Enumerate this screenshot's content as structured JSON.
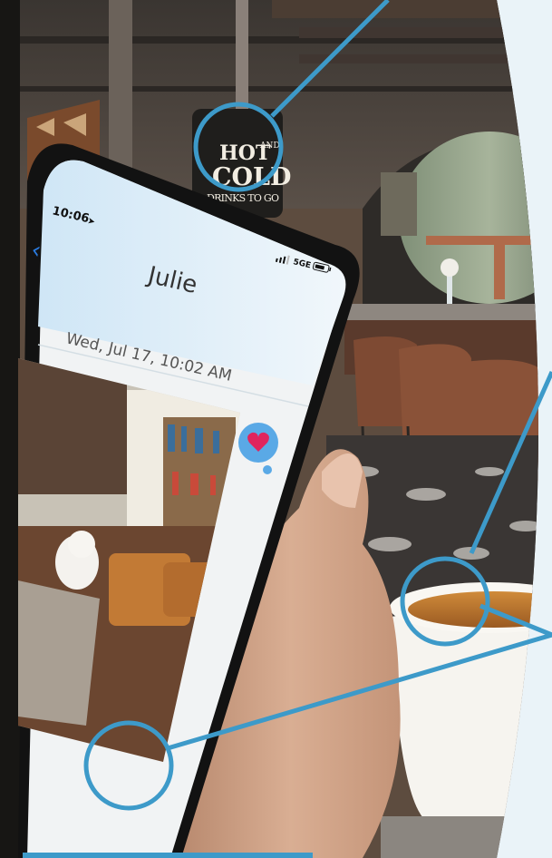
{
  "sign": {
    "line1": "HOT",
    "line2": "AND",
    "line3": "COLD",
    "line4": "DRINKS TO GO"
  },
  "phone": {
    "status_time": "10:06",
    "network": "5GE",
    "contact_name": "Julie",
    "timestamp": "Wed, Jul 17, 10:02 AM",
    "reaction": "heart"
  },
  "colors": {
    "callout_blue": "#3d9ac9",
    "panel_bg": "#eaf3f8",
    "ios_blue": "#2a7be0",
    "heart_red": "#e0245e"
  }
}
